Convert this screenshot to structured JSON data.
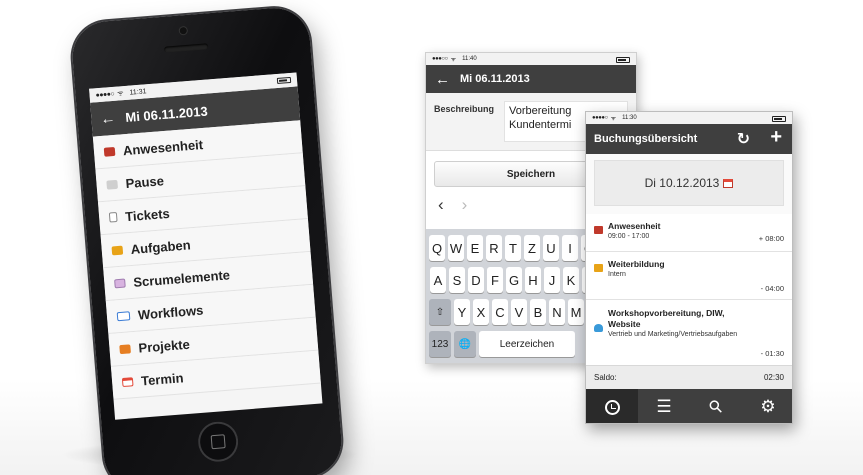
{
  "phone1": {
    "status": {
      "signal": "●●●●○",
      "wifi": "ᯤ",
      "time": "11:31"
    },
    "title": "Mi 06.11.2013",
    "menu": [
      {
        "label": "Anwesenheit",
        "icon": "briefcase-icon",
        "color": "#c0392b"
      },
      {
        "label": "Pause",
        "icon": "coffee-icon",
        "color": "#cfcfcf"
      },
      {
        "label": "Tickets",
        "icon": "ticket-icon",
        "color": "#ffffff"
      },
      {
        "label": "Aufgaben",
        "icon": "tasks-icon",
        "color": "#e8a317"
      },
      {
        "label": "Scrumelemente",
        "icon": "scrum-icon",
        "color": "#d8b3e0"
      },
      {
        "label": "Workflows",
        "icon": "workflow-icon",
        "color": "#3a7bd5"
      },
      {
        "label": "Projekte",
        "icon": "folder-icon",
        "color": "#e67e22"
      },
      {
        "label": "Termin",
        "icon": "calendar-icon",
        "color": "#e34a3a"
      }
    ]
  },
  "phone2": {
    "status": {
      "signal": "●●●○○",
      "wifi": "ᯤ",
      "time": "11:40"
    },
    "title": "Mi 06.11.2013",
    "field_label": "Beschreibung",
    "field_value_line1": "Vorbereitung",
    "field_value_line2": "Kundentermi",
    "save_label": "Speichern",
    "keyboard": {
      "row1": [
        "Q",
        "W",
        "E",
        "R",
        "T",
        "Z",
        "U",
        "I",
        "O"
      ],
      "row2": [
        "A",
        "S",
        "D",
        "F",
        "G",
        "H",
        "J",
        "K",
        "L"
      ],
      "row3": [
        "Y",
        "X",
        "C",
        "V",
        "B",
        "N",
        "M"
      ],
      "numbers_key": "123",
      "space_key": "Leerzeichen"
    }
  },
  "phone3": {
    "status": {
      "signal": "●●●●○",
      "wifi": "ᯤ",
      "time": "11:30"
    },
    "title": "Buchungsübersicht",
    "date": "Di 10.12.2013",
    "entries": [
      {
        "title": "Anwesenheit",
        "sub": "09:00 - 17:00",
        "amount": "+ 08:00",
        "icon": "briefcase-icon",
        "color": "#c0392b"
      },
      {
        "title": "Weiterbildung",
        "sub": "Intern",
        "amount": "- 04:00",
        "icon": "tasks-icon",
        "color": "#e8a317"
      },
      {
        "title": "Workshopvorbereitung, DIW,",
        "title2": "Website",
        "sub": "Vertrieb und Marketing/Vertriebsaufgaben",
        "amount": "- 01:30",
        "icon": "people-icon",
        "color": "#3a9ad9"
      }
    ],
    "saldo_label": "Saldo:",
    "saldo_value": "02:30",
    "tabs": [
      "clock-icon",
      "list-icon",
      "key-icon",
      "gear-icon"
    ]
  }
}
